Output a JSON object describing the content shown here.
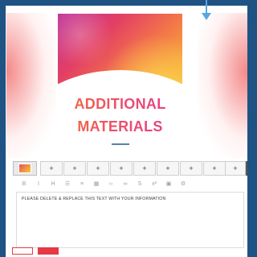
{
  "colors": {
    "frame": "#1f5384",
    "accent": "#e53946",
    "glow": "#f06060",
    "title_gradient_start": "#f26b3a",
    "title_gradient_end": "#e23f8a"
  },
  "cover": {
    "title_line1": "ADDITIONAL",
    "title_line2": "MATERIALS"
  },
  "page_strip": {
    "add_labels": [
      "+",
      "+",
      "+",
      "+",
      "+",
      "+",
      "+",
      "+",
      "+",
      "+"
    ]
  },
  "toolbar": {
    "tools": [
      {
        "icon": "bold-icon",
        "glyph": "B"
      },
      {
        "icon": "italic-icon",
        "glyph": "I"
      },
      {
        "icon": "heading-icon",
        "glyph": "H"
      },
      {
        "icon": "bulleted-list-icon",
        "glyph": "☰"
      },
      {
        "icon": "numbered-list-icon",
        "glyph": "≡"
      },
      {
        "icon": "table-icon",
        "glyph": "▦"
      },
      {
        "icon": "code-icon",
        "glyph": "‹›"
      },
      {
        "icon": "link-icon",
        "glyph": "∞"
      },
      {
        "icon": "strikethrough-icon",
        "glyph": "S"
      },
      {
        "icon": "superscript-icon",
        "glyph": "x²"
      },
      {
        "icon": "image-icon",
        "glyph": "▣"
      },
      {
        "icon": "settings-icon",
        "glyph": "⚙"
      }
    ]
  },
  "editor": {
    "text": "PLEASE DELETE & REPLACE THIS TEXT WITH YOUR INFORMATION"
  },
  "actions": {
    "outline_label": "",
    "solid_label": ""
  }
}
